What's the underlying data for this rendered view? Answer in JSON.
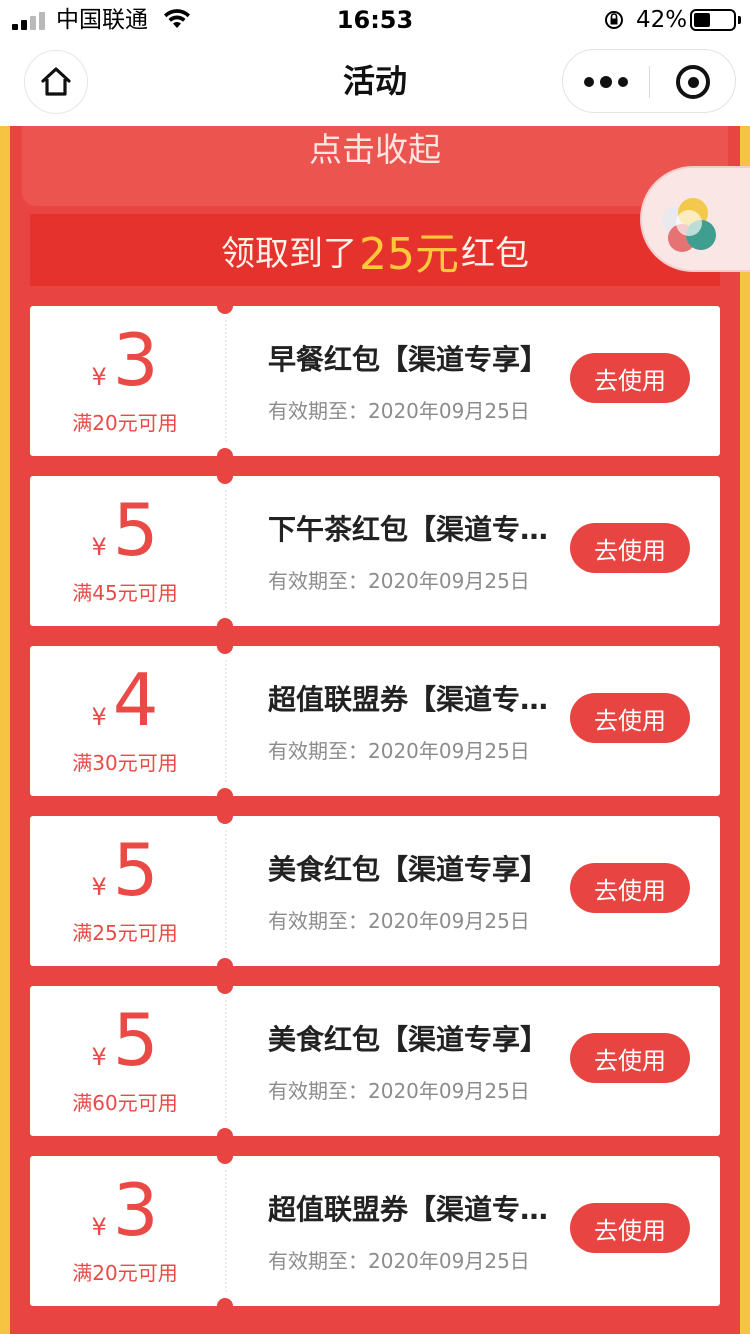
{
  "status_bar": {
    "carrier": "中国联通",
    "time": "16:53",
    "battery_percent": "42%",
    "battery_level": 0.42,
    "icons": [
      "signal-icon",
      "wifi-icon",
      "orientation-lock-icon",
      "battery-icon"
    ]
  },
  "nav": {
    "title": "活动",
    "icons": [
      "home-icon",
      "more-icon",
      "close-target-icon"
    ]
  },
  "colors": {
    "primary_red": "#e84542",
    "banner_red": "#e6322d",
    "accent_yellow": "#ffc93a",
    "side_gold": "#f6c343"
  },
  "collapse_label": "点击收起",
  "banner": {
    "prefix": "领取到了",
    "amount": "25元",
    "suffix": "红包"
  },
  "coupons": [
    {
      "currency": "¥",
      "value": "3",
      "condition": "满20元可用",
      "title": "早餐红包【渠道专享】",
      "expiry": "有效期至：2020年09月25日",
      "button": "去使用"
    },
    {
      "currency": "¥",
      "value": "5",
      "condition": "满45元可用",
      "title": "下午茶红包【渠道专…",
      "expiry": "有效期至：2020年09月25日",
      "button": "去使用"
    },
    {
      "currency": "¥",
      "value": "4",
      "condition": "满30元可用",
      "title": "超值联盟券【渠道专…",
      "expiry": "有效期至：2020年09月25日",
      "button": "去使用"
    },
    {
      "currency": "¥",
      "value": "5",
      "condition": "满25元可用",
      "title": "美食红包【渠道专享】",
      "expiry": "有效期至：2020年09月25日",
      "button": "去使用"
    },
    {
      "currency": "¥",
      "value": "5",
      "condition": "满60元可用",
      "title": "美食红包【渠道专享】",
      "expiry": "有效期至：2020年09月25日",
      "button": "去使用"
    },
    {
      "currency": "¥",
      "value": "3",
      "condition": "满20元可用",
      "title": "超值联盟券【渠道专…",
      "expiry": "有效期至：2020年09月25日",
      "button": "去使用"
    }
  ]
}
